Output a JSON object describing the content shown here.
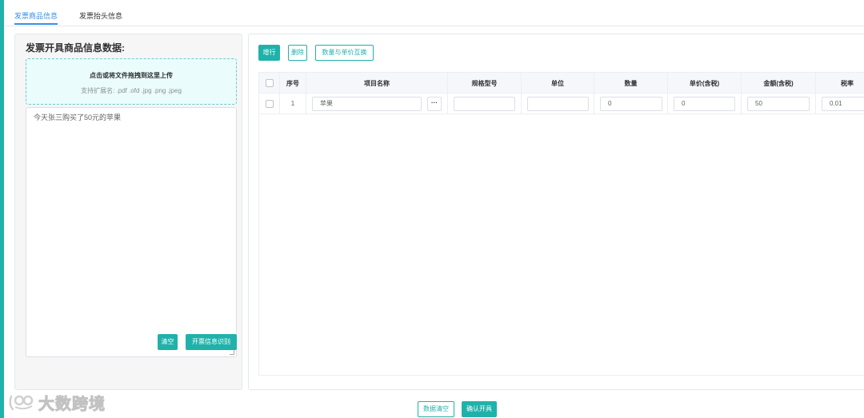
{
  "tabs": [
    {
      "label": "发票商品信息",
      "active": true
    },
    {
      "label": "发票抬头信息",
      "active": false
    }
  ],
  "left_panel": {
    "title": "发票开具商品信息数据:",
    "upload": {
      "main_text": "点击或将文件拖拽到这里上传",
      "sub_text": "支持扩展名: .pdf .ofd .jpg .png .jpeg"
    },
    "textarea_value": "今天张三购买了50元的苹果",
    "clear_label": "清空",
    "recognize_label": "开票信息识别"
  },
  "toolbar": {
    "add_label": "增行",
    "delete_label": "删除",
    "swap_label": "数量与单价互换"
  },
  "table": {
    "headers": [
      "序号",
      "项目名称",
      "规格型号",
      "单位",
      "数量",
      "单价(含税)",
      "金额(含税)",
      "税率"
    ],
    "rows": [
      {
        "seq": "1",
        "item_name": "苹果",
        "spec": "",
        "unit": "",
        "quantity": "0",
        "unit_price": "0",
        "amount": "50",
        "tax_rate": "0.01"
      }
    ]
  },
  "footer": {
    "data_clear_label": "数据清空",
    "confirm_label": "确认开具"
  },
  "watermark": {
    "text": "大数跨境"
  },
  "colors": {
    "accent": "#20b2aa",
    "tab_active": "#3a8ee6",
    "upload_bg": "#eafcfc"
  }
}
